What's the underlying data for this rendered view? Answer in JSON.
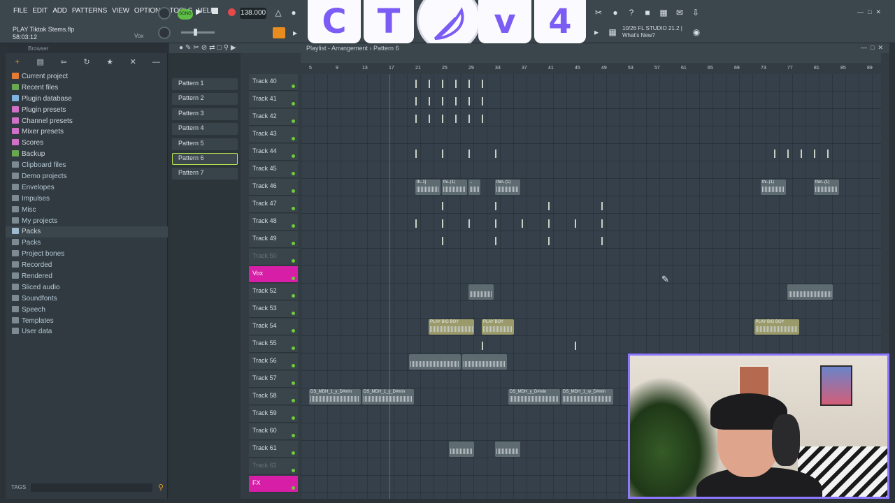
{
  "menu": [
    "FILE",
    "EDIT",
    "ADD",
    "PATTERNS",
    "VIEW",
    "OPTIONS",
    "TOOLS",
    "HELP"
  ],
  "song": {
    "title": "PLAY Tiktok Stems.flp",
    "time": "58:03:12",
    "channel": "Vox"
  },
  "transport": {
    "mode": "SONG",
    "tempo": "138.000"
  },
  "overlay": {
    "letters": [
      "C",
      "T",
      "v",
      "4"
    ],
    "feather_icon": "feather-icon"
  },
  "news": {
    "version": "10/26  FL STUDIO 21.2 |",
    "headline": "What's New?"
  },
  "browser": {
    "title": "Browser",
    "items": [
      {
        "label": "Current project",
        "color": "#e37b36",
        "sel": false
      },
      {
        "label": "Recent files",
        "color": "#6aa84f",
        "sel": false
      },
      {
        "label": "Plugin database",
        "color": "#7fb3e0",
        "sel": false
      },
      {
        "label": "Plugin presets",
        "color": "#d170c7",
        "sel": false
      },
      {
        "label": "Channel presets",
        "color": "#d170c7",
        "sel": false
      },
      {
        "label": "Mixer presets",
        "color": "#d170c7",
        "sel": false
      },
      {
        "label": "Scores",
        "color": "#d170c7",
        "sel": false
      },
      {
        "label": "Backup",
        "color": "#6aa84f",
        "sel": false
      },
      {
        "label": "Clipboard files",
        "color": "#7c8a92",
        "sel": false
      },
      {
        "label": "Demo projects",
        "color": "#7c8a92",
        "sel": false
      },
      {
        "label": "Envelopes",
        "color": "#7c8a92",
        "sel": false
      },
      {
        "label": "Impulses",
        "color": "#7c8a92",
        "sel": false
      },
      {
        "label": "Misc",
        "color": "#7c8a92",
        "sel": false
      },
      {
        "label": "My projects",
        "color": "#7c8a92",
        "sel": false
      },
      {
        "label": "Packs",
        "color": "#9fb9cf",
        "sel": true
      },
      {
        "label": "Packs",
        "color": "#7c8a92",
        "sel": false
      },
      {
        "label": "Project bones",
        "color": "#7c8a92",
        "sel": false
      },
      {
        "label": "Recorded",
        "color": "#7c8a92",
        "sel": false
      },
      {
        "label": "Rendered",
        "color": "#7c8a92",
        "sel": false
      },
      {
        "label": "Sliced audio",
        "color": "#7c8a92",
        "sel": false
      },
      {
        "label": "Soundfonts",
        "color": "#7c8a92",
        "sel": false
      },
      {
        "label": "Speech",
        "color": "#7c8a92",
        "sel": false
      },
      {
        "label": "Templates",
        "color": "#7c8a92",
        "sel": false
      },
      {
        "label": "User data",
        "color": "#7c8a92",
        "sel": false
      }
    ],
    "tags_label": "TAGS"
  },
  "playlist": {
    "title": "Playlist - Arrangement › Pattern 6",
    "patterns": [
      {
        "label": "Pattern 1",
        "sel": false
      },
      {
        "label": "Pattern 2",
        "sel": false
      },
      {
        "label": "Pattern 3",
        "sel": false
      },
      {
        "label": "Pattern 4",
        "sel": false
      },
      {
        "label": "Pattern 5",
        "sel": false
      },
      {
        "label": "Pattern 6",
        "sel": true
      },
      {
        "label": "Pattern 7",
        "sel": false
      }
    ],
    "ruler": [
      "5",
      "9",
      "13",
      "17",
      "21",
      "25",
      "29",
      "33",
      "37",
      "41",
      "45",
      "49",
      "53",
      "57",
      "61",
      "65",
      "69",
      "73",
      "77",
      "81",
      "85",
      "89"
    ],
    "tracks": [
      {
        "name": "Track 40",
        "style": "normal"
      },
      {
        "name": "Track 41",
        "style": "normal"
      },
      {
        "name": "Track 42",
        "style": "normal"
      },
      {
        "name": "Track 43",
        "style": "normal"
      },
      {
        "name": "Track 44",
        "style": "normal"
      },
      {
        "name": "Track 45",
        "style": "normal"
      },
      {
        "name": "Track 46",
        "style": "normal"
      },
      {
        "name": "Track 47",
        "style": "normal"
      },
      {
        "name": "Track 48",
        "style": "normal"
      },
      {
        "name": "Track 49",
        "style": "normal"
      },
      {
        "name": "Track 50",
        "style": "dim"
      },
      {
        "name": "Vox",
        "style": "magenta"
      },
      {
        "name": "Track 52",
        "style": "normal"
      },
      {
        "name": "Track 53",
        "style": "normal"
      },
      {
        "name": "Track 54",
        "style": "normal"
      },
      {
        "name": "Track 55",
        "style": "normal"
      },
      {
        "name": "Track 56",
        "style": "normal"
      },
      {
        "name": "Track 57",
        "style": "normal"
      },
      {
        "name": "Track 58",
        "style": "normal"
      },
      {
        "name": "Track 59",
        "style": "normal"
      },
      {
        "name": "Track 60",
        "style": "normal"
      },
      {
        "name": "Track 61",
        "style": "normal"
      },
      {
        "name": "Track 62",
        "style": "dim"
      },
      {
        "name": "FX",
        "style": "magenta"
      }
    ],
    "clips": [
      {
        "row": 6,
        "bar": 21,
        "len": 4,
        "title": "th..1]",
        "yellow": false
      },
      {
        "row": 6,
        "bar": 25,
        "len": 4,
        "title": "thi..(1)",
        "yellow": false
      },
      {
        "row": 6,
        "bar": 29,
        "len": 2,
        "title": "..",
        "yellow": false
      },
      {
        "row": 6,
        "bar": 33,
        "len": 4,
        "title": "thin..(1)",
        "yellow": false
      },
      {
        "row": 6,
        "bar": 73,
        "len": 4,
        "title": "thi..(1)",
        "yellow": false
      },
      {
        "row": 6,
        "bar": 81,
        "len": 4,
        "title": "thin..(1)",
        "yellow": false
      },
      {
        "row": 12,
        "bar": 29,
        "len": 4,
        "title": "",
        "yellow": false
      },
      {
        "row": 12,
        "bar": 77,
        "len": 7,
        "title": "",
        "yellow": false
      },
      {
        "row": 14,
        "bar": 23,
        "len": 7,
        "title": "PLAY BIG BOY",
        "yellow": true
      },
      {
        "row": 14,
        "bar": 31,
        "len": 5,
        "title": "PLAY BOY",
        "yellow": true
      },
      {
        "row": 14,
        "bar": 72,
        "len": 7,
        "title": "PLAY BIG BOY",
        "yellow": true
      },
      {
        "row": 16,
        "bar": 20,
        "len": 8,
        "title": "",
        "yellow": false
      },
      {
        "row": 16,
        "bar": 28,
        "len": 7,
        "title": "",
        "yellow": false
      },
      {
        "row": 18,
        "bar": 5,
        "len": 8,
        "title": "DS_MDH_1_y_D#min",
        "yellow": false
      },
      {
        "row": 18,
        "bar": 13,
        "len": 8,
        "title": "DS_MDH_1_y_D#min",
        "yellow": false
      },
      {
        "row": 18,
        "bar": 35,
        "len": 8,
        "title": "DS_MDH_y_D#min",
        "yellow": false
      },
      {
        "row": 18,
        "bar": 43,
        "len": 8,
        "title": "DS_MDH_1_ry_D#min",
        "yellow": false
      },
      {
        "row": 21,
        "bar": 26,
        "len": 4,
        "title": "",
        "yellow": false
      },
      {
        "row": 21,
        "bar": 33,
        "len": 4,
        "title": "",
        "yellow": false
      }
    ]
  },
  "icons": {
    "browser_tools": [
      "plus-icon",
      "folder-icon",
      "back-icon",
      "refresh-icon",
      "star-icon",
      "close-icon",
      "collapse-icon"
    ],
    "search": "search-icon"
  }
}
